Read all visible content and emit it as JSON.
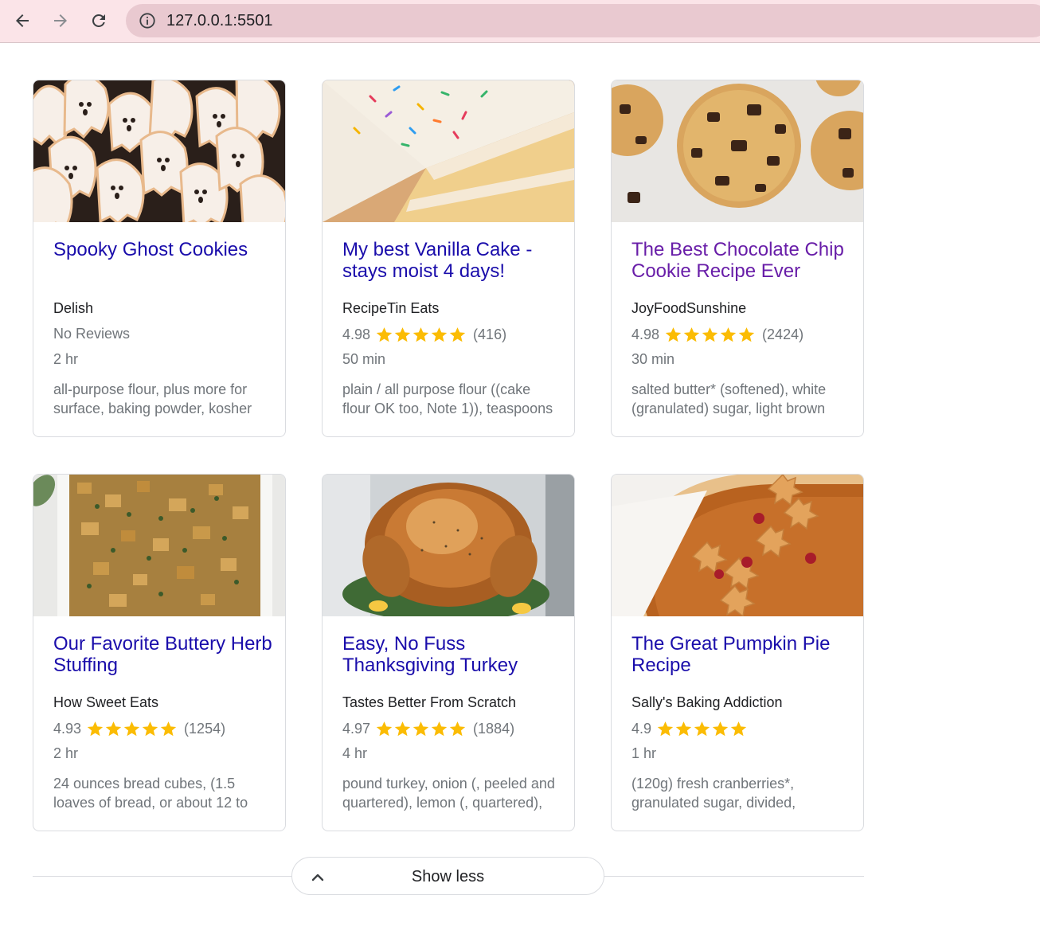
{
  "browser": {
    "url": "127.0.0.1:5501"
  },
  "recipes": [
    {
      "title": "Spooky Ghost Cookies",
      "source": "Delish",
      "reviews_text": "No Reviews",
      "time": "2 hr",
      "ingredients": "all-purpose flour, plus more for surface, baking powder, kosher",
      "image": "ghost-cookies-photo"
    },
    {
      "title": "My best Vanilla Cake - stays moist 4 days!",
      "source": "RecipeTin Eats",
      "rating": "4.98",
      "stars": 5,
      "count": "(416)",
      "time": "50 min",
      "ingredients": "plain / all purpose flour ((cake flour OK too, Note 1)), teaspoons",
      "image": "vanilla-cake-photo"
    },
    {
      "title": "The Best Chocolate Chip Cookie Recipe Ever",
      "source": "JoyFoodSunshine",
      "rating": "4.98",
      "stars": 5,
      "count": "(2424)",
      "time": "30 min",
      "ingredients": "salted butter* (softened), white (granulated) sugar, light brown",
      "image": "chocolate-chip-cookies-photo"
    },
    {
      "title": "Our Favorite Buttery Herb Stuffing",
      "source": "How Sweet Eats",
      "rating": "4.93",
      "stars": 5,
      "count": "(1254)",
      "time": "2 hr",
      "ingredients": "24 ounces bread cubes, (1.5 loaves of bread, or about 12 to",
      "image": "herb-stuffing-photo"
    },
    {
      "title": "Easy, No Fuss Thanksgiving Turkey",
      "source": "Tastes Better From Scratch",
      "rating": "4.97",
      "stars": 5,
      "count": "(1884)",
      "time": "4 hr",
      "ingredients": "pound turkey, onion (, peeled and quartered), lemon (, quartered),",
      "image": "roast-turkey-photo"
    },
    {
      "title": "The Great Pumpkin Pie Recipe",
      "source": "Sally's Baking Addiction",
      "rating": "4.9",
      "stars": 5,
      "count": "",
      "time": "1 hr",
      "ingredients": "(120g) fresh cranberries*, granulated sugar, divided,",
      "image": "pumpkin-pie-photo"
    }
  ],
  "show_less": {
    "label": "Show less"
  },
  "colors": {
    "link": "#1a0dab",
    "visited": "#681da8",
    "star": "#fbbc04",
    "muted": "#70757a"
  }
}
